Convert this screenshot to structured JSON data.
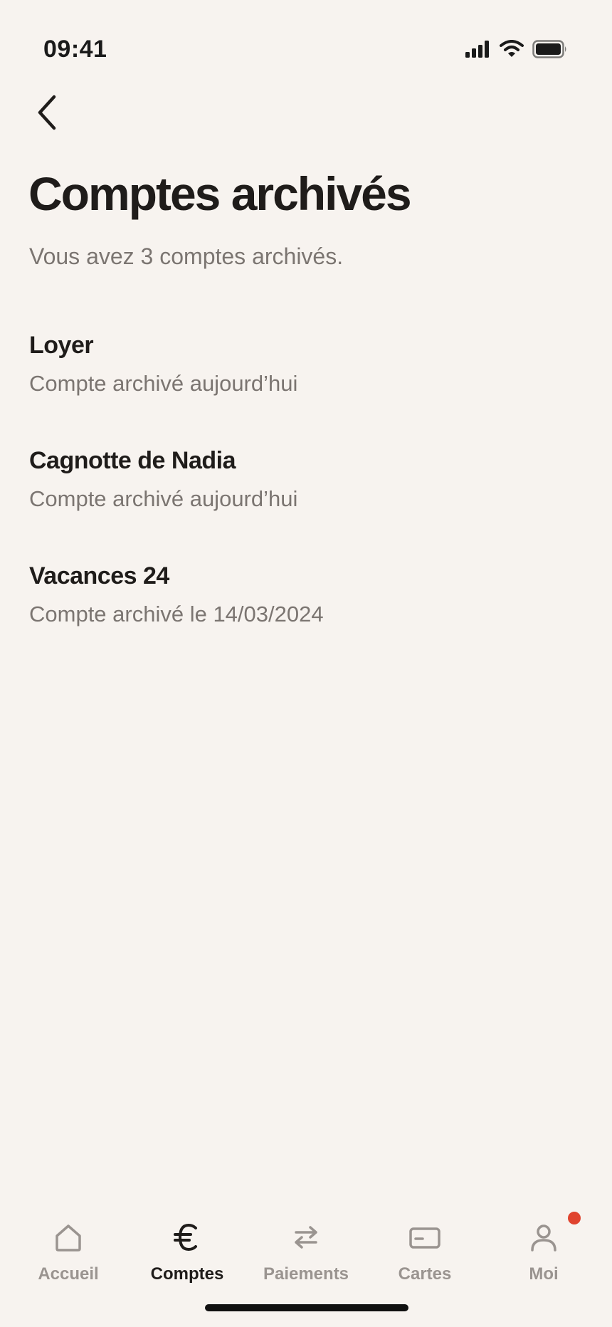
{
  "status_bar": {
    "time": "09:41"
  },
  "header": {
    "back_icon": "chevron-left-icon",
    "title": "Comptes archivés",
    "subtitle": "Vous avez 3 comptes archivés."
  },
  "accounts": [
    {
      "name": "Loyer",
      "status": "Compte archivé aujourd’hui"
    },
    {
      "name": "Cagnotte de Nadia",
      "status": "Compte archivé aujourd’hui"
    },
    {
      "name": "Vacances 24",
      "status": "Compte archivé le 14/03/2024"
    }
  ],
  "tab_bar": {
    "active": "Comptes",
    "tabs": [
      {
        "label": "Accueil",
        "icon": "home-icon"
      },
      {
        "label": "Comptes",
        "icon": "euro-icon"
      },
      {
        "label": "Paiements",
        "icon": "transfer-arrows-icon"
      },
      {
        "label": "Cartes",
        "icon": "card-icon"
      },
      {
        "label": "Moi",
        "icon": "user-icon"
      }
    ]
  },
  "colors": {
    "background": "#f7f3ef",
    "text_primary": "#1f1c1a",
    "text_secondary": "#7b7571",
    "tab_inactive": "#9a9490",
    "notification": "#e0432e"
  }
}
